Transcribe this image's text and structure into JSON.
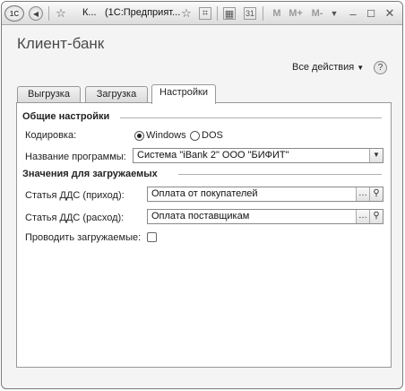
{
  "titlebar": {
    "logo": "1С",
    "short_title": "К...",
    "app_title": "(1С:Предприят...",
    "icons": [
      "back-icon",
      "star-icon",
      "star-outline-icon",
      "bookmark-icon",
      "calculator-icon",
      "calendar-icon",
      "dropdown-icon"
    ],
    "m_buttons": [
      "M",
      "M+",
      "M-"
    ]
  },
  "form": {
    "title": "Клиент-банк",
    "actions_label": "Все действия",
    "help_label": "?"
  },
  "tabs": [
    {
      "label": "Выгрузка",
      "active": false
    },
    {
      "label": "Загрузка",
      "active": false
    },
    {
      "label": "Настройки",
      "active": true
    }
  ],
  "settings": {
    "general_group": "Общие настройки",
    "encoding_label": "Кодировка:",
    "encoding_options": [
      "Windows",
      "DOS"
    ],
    "encoding_selected": "Windows",
    "program_label": "Название программы:",
    "program_value": "Система  \"iBank 2\" ООО \"БИФИТ\"",
    "imported_group": "Значения для загружаемых",
    "income_label": "Статья ДДС (приход):",
    "income_value": "Оплата от покупателей",
    "expense_label": "Статья ДДС (расход):",
    "expense_value": "Оплата поставщикам",
    "post_label": "Проводить загружаемые:",
    "post_checked": false
  }
}
